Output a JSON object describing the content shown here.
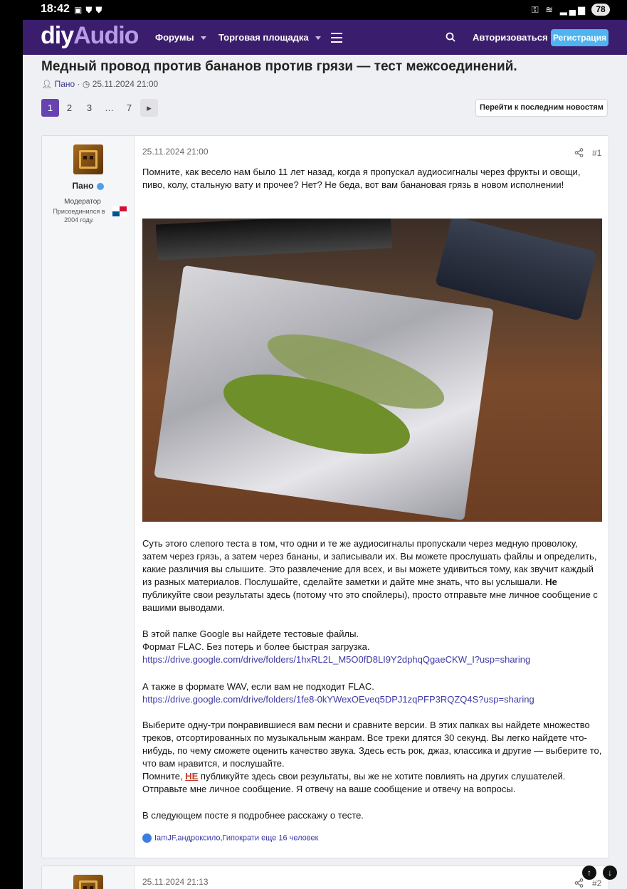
{
  "status_bar": {
    "time": "18:42",
    "left_icons": [
      "screenshot-icon",
      "shield-icon",
      "shield-icon"
    ],
    "right_icons": [
      "key-icon",
      "wifi-icon",
      "signal-icon"
    ],
    "battery": "78"
  },
  "nav": {
    "logo_part1": "diy",
    "logo_part2": "Audio",
    "forums": "Форумы",
    "marketplace": "Торговая площадка",
    "login": "Авторизоваться",
    "register": "Регистрация",
    "brand_color": "#3b1d6e",
    "accent_color": "#4fb3ef"
  },
  "thread": {
    "title": "Медный провод против бананов против грязи — тест межсоединений.",
    "author": "Пано",
    "date": "25.11.2024 21:00",
    "separator": "·"
  },
  "pagination": {
    "pages": [
      "1",
      "2",
      "3",
      "…",
      "7"
    ],
    "current": "1",
    "latest_button": "Перейти к последним новостям"
  },
  "posts": [
    {
      "author": "Пано",
      "user_title": "Модератор",
      "joined": "Присоединился в 2004 году.",
      "date": "25.11.2024 21:00",
      "number": "#1",
      "intro": "Помните, как весело нам было 11 лет назад, когда я пропускал аудиосигналы через фрукты и овощи, пиво, колу, стальную вату и прочее? Нет? Не беда, вот вам банановая грязь в новом исполнении!",
      "p1_text": "Суть этого слепого теста в том, что одни и те же аудиосигналы пропускали через медную проволоку, затем через грязь, а затем через бананы, и записывали их. Вы можете прослушать файлы и определить, какие различия вы слышите. Это развлечение для всех, и вы можете удивиться тому, как звучит каждый из разных материалов. Послушайте, сделайте заметки и дайте мне знать, что вы услышали.",
      "p1_bold": "Не",
      "p1_tail": "публикуйте свои результаты здесь (потому что это спойлеры), просто отправьте мне личное сообщение с вашими выводами.",
      "google_intro": "В этой папке Google вы найдете тестовые файлы.",
      "flac_note": "Формат FLAC. Без потерь и более быстрая загрузка.",
      "flac_link": "https://drive.google.com/drive/folders/1hxRL2L_M5O0fD8LI9Y2dphqQgaeCKW_I?usp=sharing",
      "wav_note": "А также в формате WAV, если вам не подходит FLAC.",
      "wav_link": "https://drive.google.com/drive/folders/1fe8-0kYWexOEveq5DPJ1zqPFP3RQZQ4S?usp=sharing",
      "p3": "Выберите одну-три понравившиеся вам песни и сравните версии. В этих папках вы найдете множество треков, отсортированных по музыкальным жанрам. Все треки длятся 30 секунд. Вы легко найдете что-нибудь, по чему сможете оценить качество звука. Здесь есть рок, джаз, классика и другие — выберите то, что вам нравится, и послушайте.",
      "reminder_pre": "Помните,",
      "reminder_ne": "НЕ",
      "reminder_post": "публикуйте здесь свои результаты, вы же не хотите повлиять на других слушателей.",
      "reminder_line2": "Отправьте мне личное сообщение. Я отвечу на ваше сообщение и отвечу на вопросы.",
      "next_post": "В следующем посте я подробнее расскажу о тесте.",
      "reactions": "IamJF,андроксило,Гипократи еще 16 человек"
    },
    {
      "date": "25.11.2024 21:13",
      "number": "#2"
    }
  ]
}
